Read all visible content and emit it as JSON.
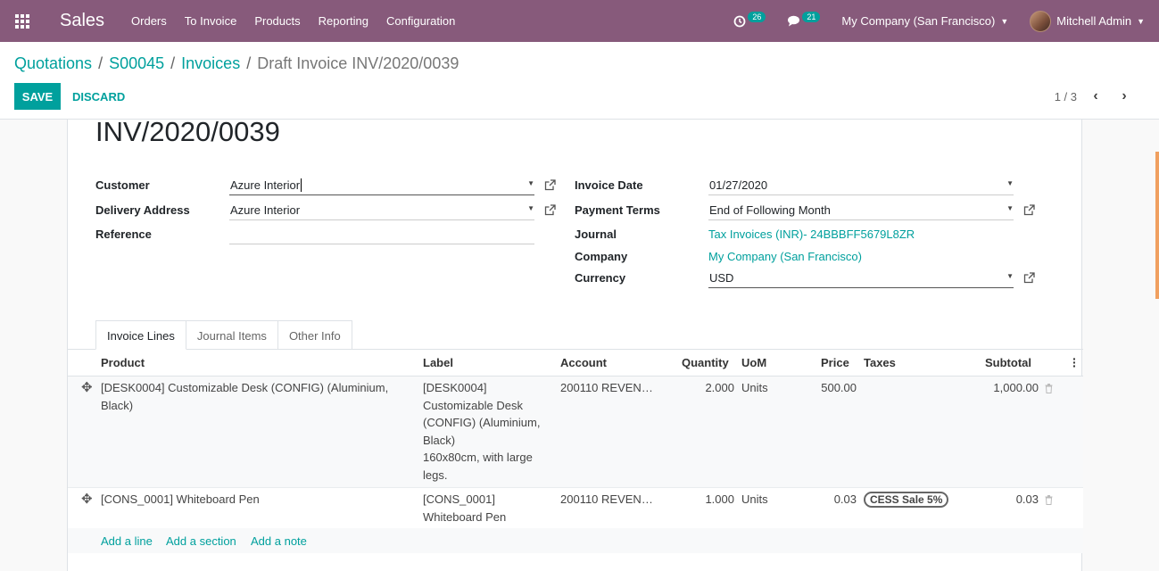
{
  "topbar": {
    "app_name": "Sales",
    "menu": [
      "Orders",
      "To Invoice",
      "Products",
      "Reporting",
      "Configuration"
    ],
    "activity_count": "26",
    "messages_count": "21",
    "company": "My Company (San Francisco)",
    "user": "Mitchell Admin"
  },
  "breadcrumb": {
    "items": [
      "Quotations",
      "S00045",
      "Invoices"
    ],
    "current": "Draft Invoice INV/2020/0039"
  },
  "buttons": {
    "save": "SAVE",
    "discard": "DISCARD"
  },
  "pager": {
    "value": "1 / 3"
  },
  "invoice": {
    "number": "INV/2020/0039",
    "customer_label": "Customer",
    "customer": "Azure Interior",
    "delivery_label": "Delivery Address",
    "delivery": "Azure Interior",
    "reference_label": "Reference",
    "reference": "",
    "date_label": "Invoice Date",
    "date": "01/27/2020",
    "terms_label": "Payment Terms",
    "terms": "End of Following Month",
    "journal_label": "Journal",
    "journal": "Tax Invoices (INR)- 24BBBFF5679L8ZR",
    "company_label": "Company",
    "company": "My Company (San Francisco)",
    "currency_label": "Currency",
    "currency": "USD"
  },
  "tabs": [
    "Invoice Lines",
    "Journal Items",
    "Other Info"
  ],
  "columns": {
    "product": "Product",
    "label": "Label",
    "account": "Account",
    "quantity": "Quantity",
    "uom": "UoM",
    "price": "Price",
    "taxes": "Taxes",
    "subtotal": "Subtotal"
  },
  "lines": [
    {
      "product": "[DESK0004] Customizable Desk (CONFIG) (Aluminium, Black)",
      "label_lines": [
        "[DESK0004]",
        "Customizable Desk",
        "(CONFIG) (Aluminium,",
        "Black)",
        "160x80cm, with large",
        "legs."
      ],
      "account": "200110 REVEN…",
      "quantity": "2.000",
      "uom": "Units",
      "price": "500.00",
      "tax": "",
      "subtotal": "1,000.00"
    },
    {
      "product": "[CONS_0001] Whiteboard Pen",
      "label_lines": [
        "[CONS_0001]",
        "Whiteboard Pen"
      ],
      "account": "200110 REVEN…",
      "quantity": "1.000",
      "uom": "Units",
      "price": "0.03",
      "tax": "CESS Sale 5%",
      "subtotal": "0.03"
    }
  ],
  "add_links": {
    "line": "Add a line",
    "section": "Add a section",
    "note": "Add a note"
  }
}
